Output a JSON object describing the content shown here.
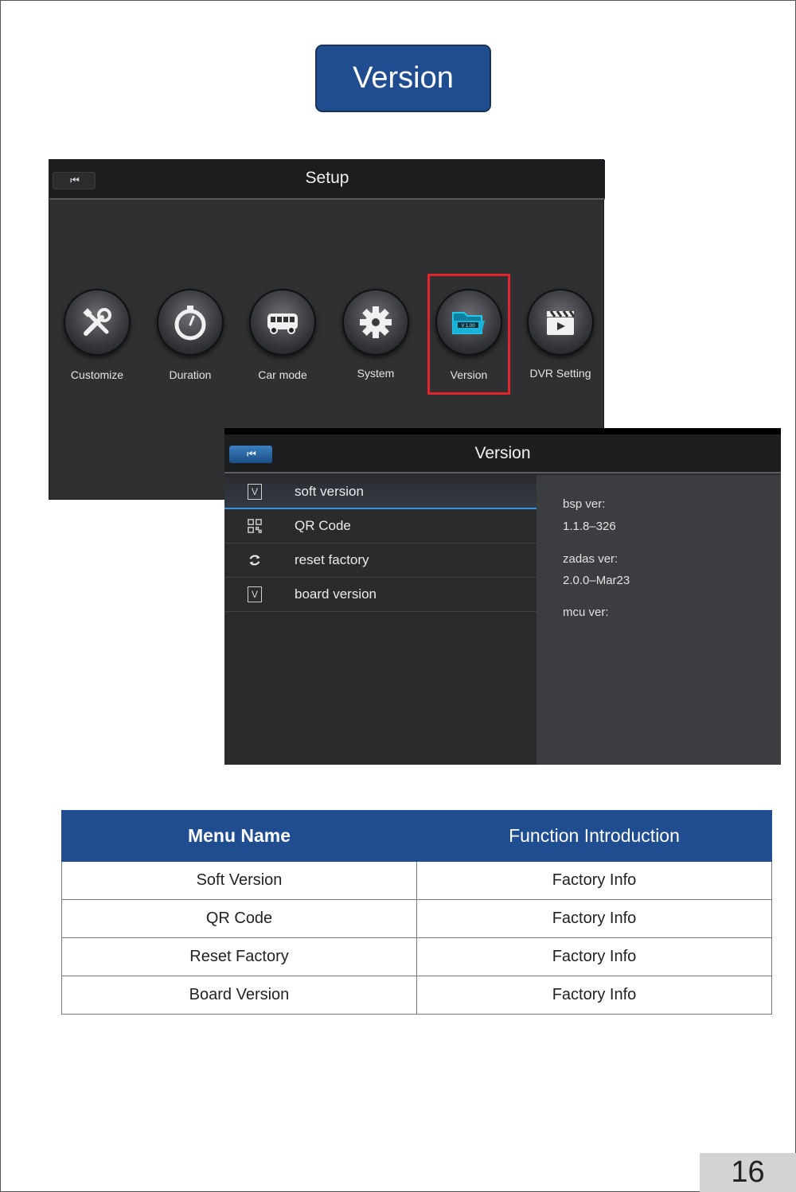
{
  "heading": "Version",
  "setup_screen": {
    "title": "Setup",
    "back_icon": "⏮",
    "icons": [
      {
        "label": "Customize",
        "icon": "tools-icon"
      },
      {
        "label": "Duration",
        "icon": "stopwatch-icon"
      },
      {
        "label": "Car mode",
        "icon": "bus-icon"
      },
      {
        "label": "System",
        "icon": "gear-icon"
      },
      {
        "label": "Version",
        "icon": "version-folder-icon",
        "selected": true
      },
      {
        "label": "DVR Setting",
        "icon": "clapperboard-icon"
      }
    ],
    "version_badge": "V 1.00"
  },
  "version_screen": {
    "title": "Version",
    "back_icon": "⏮",
    "menu": [
      {
        "label": "soft version",
        "icon": "V"
      },
      {
        "label": "QR Code",
        "icon": "qr-icon"
      },
      {
        "label": "reset factory",
        "icon": "refresh-icon"
      },
      {
        "label": "board version",
        "icon": "V"
      }
    ],
    "info": {
      "bsp_label": "bsp ver:",
      "bsp_value": "1.1.8–326",
      "zadas_label": "zadas ver:",
      "zadas_value": "2.0.0–Mar23",
      "mcu_label": "mcu ver:"
    }
  },
  "table": {
    "headers": [
      "Menu Name",
      "Function Introduction"
    ],
    "rows": [
      [
        "Soft Version",
        "Factory Info"
      ],
      [
        "QR Code",
        "Factory Info"
      ],
      [
        "Reset Factory",
        "Factory Info"
      ],
      [
        "Board Version",
        "Factory Info"
      ]
    ]
  },
  "page_number": "16",
  "colors": {
    "brand_blue": "#1f4d8f",
    "highlight_red": "#e0262b",
    "accent_cyan": "#21c8e8"
  }
}
